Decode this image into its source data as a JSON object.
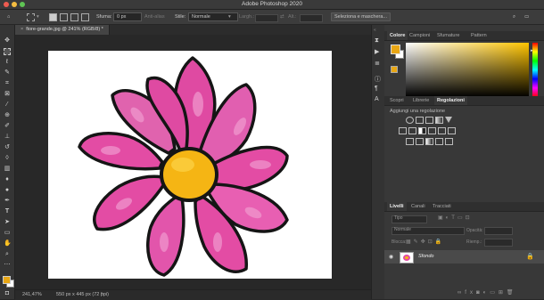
{
  "window": {
    "title": "Adobe Photoshop 2020"
  },
  "options_bar": {
    "feather_label": "Sfuma:",
    "feather_value": "0 px",
    "antialias_label": "Anti-alias",
    "style_label": "Stile:",
    "style_value": "Normale",
    "width_label": "Largh.:",
    "height_label": "Alt.:",
    "select_mask_button": "Seleziona e maschera..."
  },
  "document": {
    "tab_label": "fiore-grande.jpg @ 241% (RGB/8) *",
    "zoom": "241,47%",
    "info": "550 px x 445 px (72 ppi)"
  },
  "color_panel": {
    "tabs": [
      "Colore",
      "Campioni",
      "Sfumature",
      "Pattern"
    ],
    "active_tab": "Colore",
    "foreground": "#e8a614",
    "background": "#ffffff",
    "hue_color": "#ffc400"
  },
  "adjust_panel": {
    "tabs": [
      "Scopri",
      "Librerie",
      "Regolazioni"
    ],
    "active_tab": "Regolazioni",
    "add_label": "Aggiungi una regolazione"
  },
  "layers_panel": {
    "tabs": [
      "Livelli",
      "Canali",
      "Tracciati"
    ],
    "active_tab": "Livelli",
    "filter_label": "Tipo",
    "blend_mode": "Normale",
    "opacity_label": "Opacità:",
    "lock_label": "Blocca:",
    "fill_label": "Riemp.:",
    "layers": [
      {
        "name": "Sfondo",
        "visible": true,
        "locked": true
      }
    ]
  }
}
